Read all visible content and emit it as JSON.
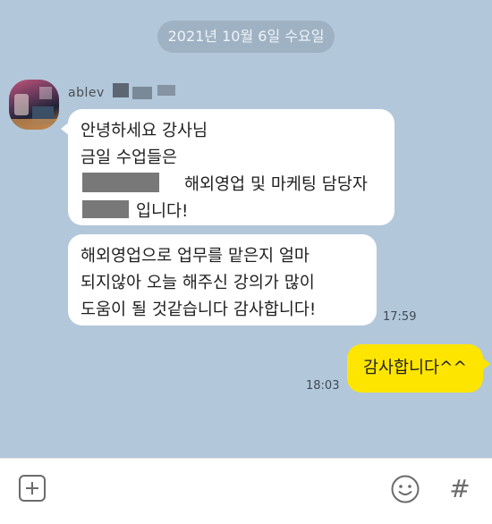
{
  "chat": {
    "date_divider": "2021년 10월 6일 수요일",
    "sender": {
      "name": "ablev"
    },
    "messages": [
      {
        "lines": [
          "안녕하세요 강사님",
          "금일 수업들은",
          "해외영업 및 마케팅 담당자",
          "입니다!"
        ]
      },
      {
        "lines": [
          "해외영업으로 업무를 맡은지 얼마",
          "되지않아 오늘 해주신 강의가 많이",
          "도움이 될 것같습니다 감사합니다!"
        ],
        "time": "17:59"
      }
    ],
    "my_message": {
      "text": "감사합니다^^",
      "time": "18:03"
    }
  },
  "input_bar": {
    "plus_icon": "plus-square-icon",
    "emoji_icon": "smile-icon",
    "hash_icon": "hash-icon",
    "hash_glyph": "#"
  },
  "colors": {
    "background": "#b2c7da",
    "incoming_bubble": "#ffffff",
    "outgoing_bubble": "#fee500"
  }
}
